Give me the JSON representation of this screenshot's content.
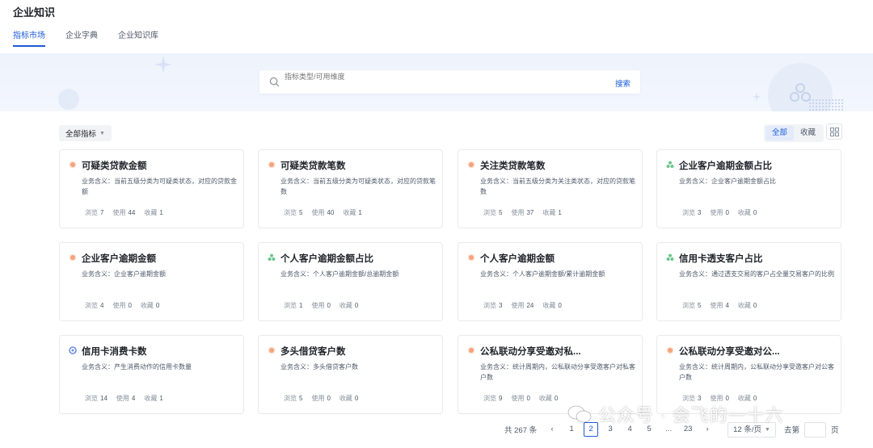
{
  "app": {
    "title": "企业知识"
  },
  "tabs": [
    {
      "label": "指标市场",
      "active": true
    },
    {
      "label": "企业字典",
      "active": false
    },
    {
      "label": "企业知识库",
      "active": false
    }
  ],
  "search": {
    "placeholder": "指标类型/可用维度",
    "button_label": "搜索",
    "icon": "search-icon"
  },
  "filter": {
    "label": "全部指标",
    "icon": "chevron-down-icon"
  },
  "view_toggle": {
    "all_label": "全部",
    "favorites_label": "收藏",
    "active": "all",
    "grid_icon": "grid-icon"
  },
  "stat_labels": {
    "views": "浏览",
    "uses": "使用",
    "favorites": "收藏"
  },
  "colors": {
    "accent": "#1d5bd8",
    "dot_orange": "#f5a37c",
    "dot_green": "#6cc48b",
    "dot_blue": "#6d8fe3"
  },
  "cards": [
    {
      "title": "可疑类贷款金额",
      "desc": "业务含义：当前五级分类为可疑类状态，对应的贷款金额",
      "dot": "orange",
      "views": "7",
      "uses": "44",
      "favorites": "1"
    },
    {
      "title": "可疑类贷款笔数",
      "desc": "业务含义：当前五级分类为可疑类状态，对应的贷款笔数",
      "dot": "orange",
      "views": "5",
      "uses": "40",
      "favorites": "1"
    },
    {
      "title": "关注类贷款笔数",
      "desc": "业务含义：当前五级分类为关注类状态，对应的贷款笔数",
      "dot": "orange",
      "views": "5",
      "uses": "37",
      "favorites": "1"
    },
    {
      "title": "企业客户逾期金额占比",
      "desc": "业务含义：企业客户逾期金额占比",
      "dot": "green",
      "views": "3",
      "uses": "0",
      "favorites": "0"
    },
    {
      "title": "企业客户逾期金额",
      "desc": "业务含义：企业客户逾期金额",
      "dot": "orange",
      "views": "4",
      "uses": "0",
      "favorites": "0"
    },
    {
      "title": "个人客户逾期金额占比",
      "desc": "业务含义：个人客户逾期金额/总逾期金额",
      "dot": "green",
      "views": "1",
      "uses": "0",
      "favorites": "0"
    },
    {
      "title": "个人客户逾期金额",
      "desc": "业务含义：个人客户逾期金额/累计逾期金额",
      "dot": "orange",
      "views": "3",
      "uses": "24",
      "favorites": "0"
    },
    {
      "title": "信用卡透支客户占比",
      "desc": "业务含义：通过透支交易的客户占全量交易客户的比例",
      "dot": "green",
      "views": "5",
      "uses": "4",
      "favorites": "0"
    },
    {
      "title": "信用卡消费卡数",
      "desc": "业务含义：产生消费动作的信用卡数量",
      "dot": "blue",
      "views": "14",
      "uses": "4",
      "favorites": "1"
    },
    {
      "title": "多头借贷客户数",
      "desc": "业务含义：多头借贷客户数",
      "dot": "orange",
      "views": "5",
      "uses": "0",
      "favorites": "0"
    },
    {
      "title": "公私联动分享受邀对私...",
      "desc": "业务含义：统计周期内，公私联动分享受邀客户对私客户数",
      "dot": "orange",
      "views": "9",
      "uses": "0",
      "favorites": "0"
    },
    {
      "title": "公私联动分享受邀对公...",
      "desc": "业务含义：统计周期内，公私联动分享受邀客户对公客户数",
      "dot": "orange",
      "views": "3",
      "uses": "0",
      "favorites": "0"
    }
  ],
  "pagination": {
    "total_text": "共 267 条",
    "prev_icon": "chevron-left-icon",
    "pages": [
      "1",
      "2",
      "3",
      "4",
      "5",
      "...",
      "23"
    ],
    "current": "2",
    "next_icon": "chevron-right-icon",
    "page_size": "12 条/页",
    "jump_prefix": "去第",
    "jump_suffix": "页"
  },
  "watermark": {
    "text": "公众号 · 会飞的一十六",
    "icon": "wechat-icon"
  }
}
